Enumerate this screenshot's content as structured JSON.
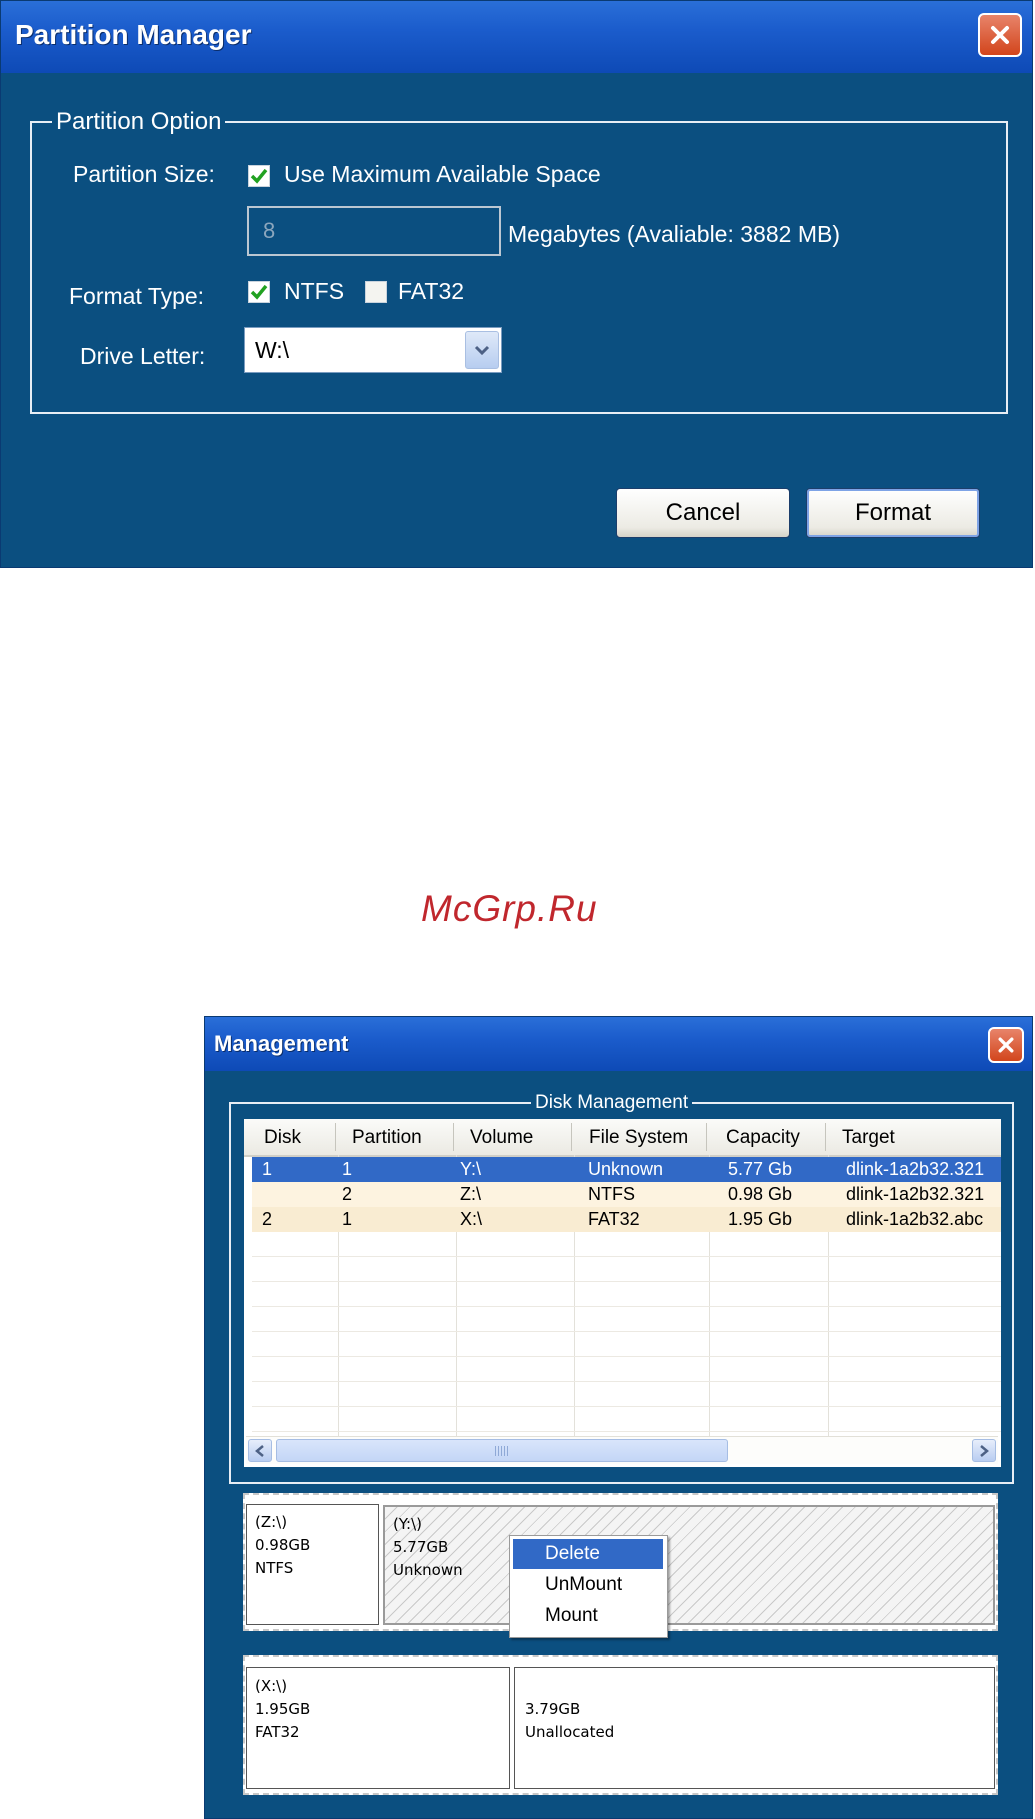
{
  "partition_manager": {
    "title": "Partition Manager",
    "group_label": "Partition Option",
    "partition_size_label": "Partition Size:",
    "use_max_label": "Use Maximum Available Space",
    "use_max_checked": true,
    "size_value": "8",
    "size_unit_text": "Megabytes (Avaliable: 3882 MB)",
    "format_type_label": "Format Type:",
    "ntfs_label": "NTFS",
    "ntfs_checked": true,
    "fat32_label": "FAT32",
    "fat32_checked": false,
    "drive_letter_label": "Drive Letter:",
    "drive_letter_value": "W:\\",
    "cancel_label": "Cancel",
    "format_label": "Format"
  },
  "watermark": "McGrp.Ru",
  "management": {
    "title": "Management",
    "group_label": "Disk Management",
    "columns": [
      "Disk",
      "Partition",
      "Volume",
      "File System",
      "Capacity",
      "Target"
    ],
    "rows": [
      {
        "disk": "1",
        "partition": "1",
        "volume": "Y:\\",
        "file_system": "Unknown",
        "capacity": "5.77 Gb",
        "target": "dlink-1a2b32.321"
      },
      {
        "disk": "",
        "partition": "2",
        "volume": "Z:\\",
        "file_system": "NTFS",
        "capacity": "0.98 Gb",
        "target": "dlink-1a2b32.321"
      },
      {
        "disk": "2",
        "partition": "1",
        "volume": "X:\\",
        "file_system": "FAT32",
        "capacity": "1.95 Gb",
        "target": "dlink-1a2b32.abc"
      }
    ],
    "selected_row": 0,
    "disk1_partitions": [
      {
        "volume": "(Z:\\)",
        "size": "0.98GB",
        "fs": "NTFS"
      },
      {
        "volume": "(Y:\\)",
        "size": "5.77GB",
        "fs": "Unknown"
      }
    ],
    "disk2_partitions": [
      {
        "volume": "(X:\\)",
        "size": "1.95GB",
        "fs": "FAT32"
      },
      {
        "volume": "",
        "size": "3.79GB",
        "fs": "Unallocated"
      }
    ],
    "context_menu": [
      "Delete",
      "UnMount",
      "Mount"
    ],
    "context_menu_highlighted": "Delete"
  },
  "colors": {
    "window_bg": "#0b4f80",
    "titlebar": "#1b5ccc",
    "selection": "#3169c6",
    "watermark": "#c0272d"
  },
  "icons": [
    "close-icon",
    "checkmark-icon",
    "chevron-down-icon",
    "chevron-left-icon",
    "chevron-right-icon"
  ]
}
